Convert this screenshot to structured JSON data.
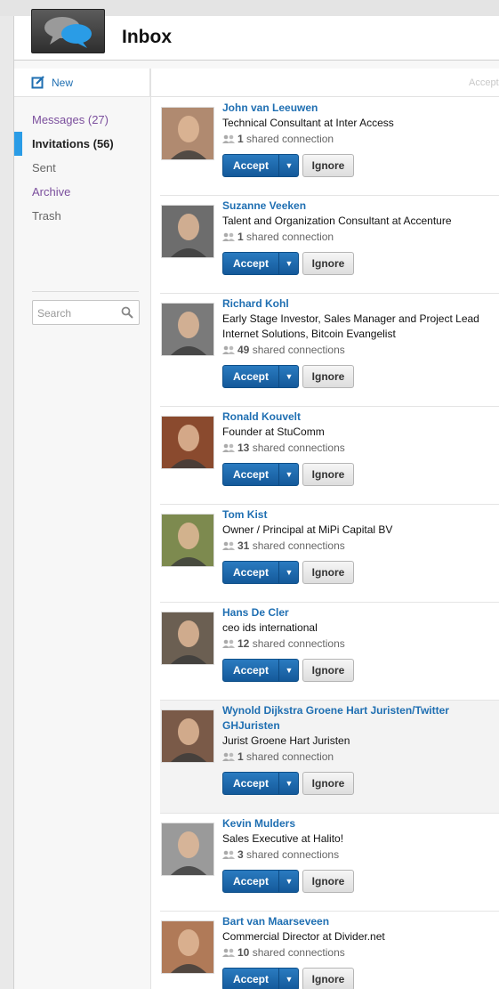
{
  "header": {
    "title": "Inbox",
    "logo_icon": "chat-bubbles-icon"
  },
  "sidebar": {
    "new_label": "New",
    "nav": [
      {
        "label": "Messages (27)",
        "style": "purple"
      },
      {
        "label": "Invitations (56)",
        "style": "active"
      },
      {
        "label": "Sent",
        "style": "gray"
      },
      {
        "label": "Archive",
        "style": "purple"
      },
      {
        "label": "Trash",
        "style": "gray"
      }
    ],
    "search_placeholder": "Search"
  },
  "bulk": {
    "accept_label": "Accept"
  },
  "buttons": {
    "accept": "Accept",
    "ignore": "Ignore"
  },
  "invitations": [
    {
      "name": "John van Leeuwen",
      "headline": "Technical Consultant at Inter Access",
      "count": "1",
      "shared": "shared connection",
      "photo": "#b08a70"
    },
    {
      "name": "Suzanne Veeken",
      "headline": "Talent and Organization Consultant at Accenture",
      "count": "1",
      "shared": "shared connection",
      "photo": "#6d6d6d"
    },
    {
      "name": "Richard Kohl",
      "headline": "Early Stage Investor, Sales Manager and Project Lead Internet Solutions, Bitcoin Evangelist",
      "count": "49",
      "shared": "shared connections",
      "photo": "#7a7a7a"
    },
    {
      "name": "Ronald Kouvelt",
      "headline": "Founder at StuComm",
      "count": "13",
      "shared": "shared connections",
      "photo": "#8a4a2e"
    },
    {
      "name": "Tom Kist",
      "headline": "Owner / Principal at MiPi Capital BV",
      "count": "31",
      "shared": "shared connections",
      "photo": "#7d8a4f"
    },
    {
      "name": "Hans De Cler",
      "headline": "ceo ids international",
      "count": "12",
      "shared": "shared connections",
      "photo": "#6b5f52"
    },
    {
      "name": "Wynold Dijkstra Groene Hart Juristen/Twitter GHJuristen",
      "headline": "Jurist Groene Hart Juristen",
      "count": "1",
      "shared": "shared connection",
      "photo": "#7a5a48"
    },
    {
      "name": "Kevin Mulders",
      "headline": "Sales Executive at Halito!",
      "count": "3",
      "shared": "shared connections",
      "photo": "#9a9a9a"
    },
    {
      "name": "Bart van Maarseveen",
      "headline": "Commercial Director at Divider.net",
      "count": "10",
      "shared": "shared connections",
      "photo": "#b07a58"
    }
  ]
}
